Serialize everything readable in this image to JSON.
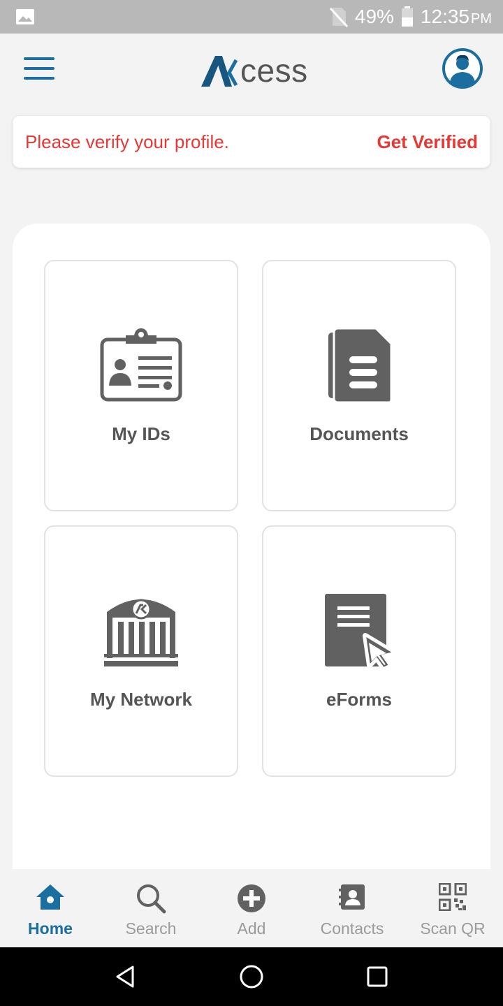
{
  "status_bar": {
    "battery": "49%",
    "time": "12:35",
    "ampm": "PM"
  },
  "app": {
    "logo_text": "cess",
    "logo_mark": "Ʌ"
  },
  "banner": {
    "message": "Please verify your profile.",
    "action": "Get Verified"
  },
  "tiles": [
    {
      "label": "My IDs",
      "icon": "id-card-icon"
    },
    {
      "label": "Documents",
      "icon": "document-icon"
    },
    {
      "label": "My Network",
      "icon": "institution-icon"
    },
    {
      "label": "eForms",
      "icon": "eform-icon"
    }
  ],
  "bottom_nav": [
    {
      "label": "Home",
      "icon": "home-icon",
      "active": true
    },
    {
      "label": "Search",
      "icon": "search-icon"
    },
    {
      "label": "Add",
      "icon": "add-icon"
    },
    {
      "label": "Contacts",
      "icon": "contacts-icon"
    },
    {
      "label": "Scan QR",
      "icon": "qr-icon"
    }
  ],
  "colors": {
    "accent": "#1a6fa0",
    "alert": "#e53935",
    "icon_gray": "#616161"
  }
}
